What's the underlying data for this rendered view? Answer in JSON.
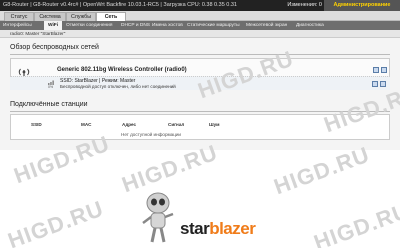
{
  "topbar": {
    "title": "G8-Router | G8-Router v0.4rc# | OpenWrt Backfire 10.03.1-RC5 | Загрузка CPU: 0.38 0.35 0.31",
    "changes": "Изменения: 0",
    "admin": "Администрирование"
  },
  "tabs1": [
    "Статус",
    "Система",
    "Службы",
    "Сеть"
  ],
  "tabs2": [
    "Интерфейсы",
    "WiFi",
    "Отметки соединения",
    "DHCP и DNS",
    "Имена хостов",
    "Статические маршруты",
    "Межсетевой экран",
    "Диагностика"
  ],
  "tabs3": [
    "radio0: Master \"StarBlazer\""
  ],
  "wireless": {
    "section_title": "Обзор беспроводных сетей",
    "controller": "Generic 802.11bg Wireless Controller (radio0)",
    "ssid_line": "SSID: StarBlazer | Режим: Master",
    "status_line": "Беспроводной доступ отключен, либо нет соединений",
    "sig_label": "0%"
  },
  "stations": {
    "section_title": "Подключённые станции",
    "headers": [
      "SSID",
      "MAC",
      "Адрес",
      "Сигнал",
      "Шум"
    ],
    "empty": "Нет доступной информации"
  },
  "brand": {
    "part1": "star",
    "part2": "blazer"
  },
  "watermark": "HIGD.RU",
  "colors": {
    "accent": "#f07c1a",
    "admin": "#ffd200"
  }
}
